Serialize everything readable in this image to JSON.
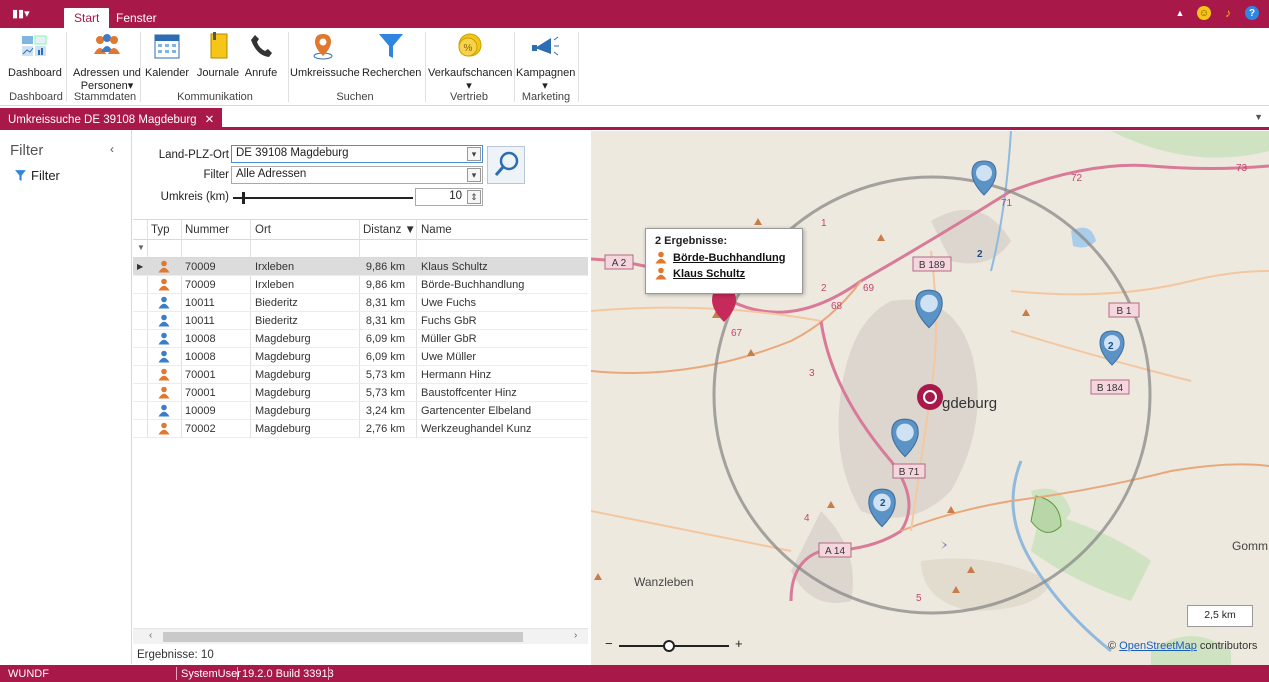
{
  "titlebar": {
    "menu_glyph": "▮▮▾",
    "tabs": [
      "Start",
      "Fenster"
    ],
    "active_tab": "Start"
  },
  "ribbon": {
    "buttons": [
      {
        "label": "Dashboard",
        "icon": "dashboard-icon"
      },
      {
        "label": "Adressen und",
        "label2": "Personen▾",
        "icon": "people-icon"
      },
      {
        "label": "Kalender",
        "icon": "calendar-icon"
      },
      {
        "label": "Journale",
        "icon": "journal-icon"
      },
      {
        "label": "Anrufe",
        "icon": "phone-icon"
      },
      {
        "label": "Umkreissuche",
        "icon": "location-pin-icon"
      },
      {
        "label": "Recherchen",
        "icon": "funnel-icon"
      },
      {
        "label": "Verkaufschancen",
        "label2": "▾",
        "icon": "percent-coin-icon"
      },
      {
        "label": "Kampagnen",
        "label2": "▾",
        "icon": "megaphone-icon"
      }
    ],
    "groups": [
      "Dashboard",
      "Stammdaten",
      "Kommunikation",
      "Suchen",
      "Vertrieb",
      "Marketing"
    ]
  },
  "doc_tab": {
    "label": "Umkreissuche DE 39108 Magdeburg",
    "close": "✕"
  },
  "left_panel": {
    "title": "Filter",
    "collapse": "‹",
    "filter_item": "Filter"
  },
  "form": {
    "plz_label": "Land-PLZ-Ort",
    "plz_value": "DE 39108 Magdeburg",
    "filter_label": "Filter",
    "filter_value": "Alle Adressen",
    "radius_label": "Umkreis (km)",
    "radius_value": "10",
    "radius_fraction": 0.05
  },
  "table": {
    "headers": [
      "Typ",
      "Nummer",
      "Ort",
      "Distanz ▼",
      "Name"
    ],
    "rows": [
      {
        "type": "orange",
        "nummer": "70009",
        "ort": "Irxleben",
        "distanz": "9,86 km",
        "name": "Klaus Schultz",
        "selected": true
      },
      {
        "type": "orange",
        "nummer": "70009",
        "ort": "Irxleben",
        "distanz": "9,86 km",
        "name": "Börde-Buchhandlung",
        "selected": false
      },
      {
        "type": "blue",
        "nummer": "10011",
        "ort": "Biederitz",
        "distanz": "8,31 km",
        "name": "Uwe Fuchs",
        "selected": false
      },
      {
        "type": "blue",
        "nummer": "10011",
        "ort": "Biederitz",
        "distanz": "8,31 km",
        "name": "Fuchs GbR",
        "selected": false
      },
      {
        "type": "blue",
        "nummer": "10008",
        "ort": "Magdeburg",
        "distanz": "6,09 km",
        "name": "Müller GbR",
        "selected": false
      },
      {
        "type": "blue",
        "nummer": "10008",
        "ort": "Magdeburg",
        "distanz": "6,09 km",
        "name": "Uwe Müller",
        "selected": false
      },
      {
        "type": "orange",
        "nummer": "70001",
        "ort": "Magdeburg",
        "distanz": "5,73 km",
        "name": "Hermann Hinz",
        "selected": false
      },
      {
        "type": "orange",
        "nummer": "70001",
        "ort": "Magdeburg",
        "distanz": "5,73 km",
        "name": "Baustoffcenter Hinz",
        "selected": false
      },
      {
        "type": "blue",
        "nummer": "10009",
        "ort": "Magdeburg",
        "distanz": "3,24 km",
        "name": "Gartencenter Elbeland",
        "selected": false
      },
      {
        "type": "orange",
        "nummer": "70002",
        "ort": "Magdeburg",
        "distanz": "2,76 km",
        "name": "Werkzeughandel Kunz",
        "selected": false
      }
    ],
    "result_count": "Ergebnisse: 10"
  },
  "map": {
    "popup_title": "2 Ergebnisse:",
    "popup_items": [
      "Börde-Buchhandlung",
      "Klaus Schultz"
    ],
    "city_label": "Magdeburg",
    "city_label_shown": "gdeburg",
    "place_labels": [
      "Wanzleben",
      "Gomm"
    ],
    "road_labels": [
      "A 2",
      "B 189",
      "B 1",
      "B 184",
      "B 71",
      "A 14",
      "73",
      "72",
      "71",
      "69",
      "68",
      "2",
      "3",
      "4",
      "1",
      "67",
      "5"
    ],
    "cluster_count": "2",
    "scale": "2,5 km",
    "copyright_prefix": "© ",
    "copyright_link": "OpenStreetMap",
    "copyright_suffix": " contributors",
    "zoom_minus": "−",
    "zoom_plus": "+",
    "zoom_level_fraction": 0.45
  },
  "status": {
    "app": "WUNDF",
    "user": "SystemUser",
    "version": "19.2.0 Build 33913"
  },
  "colors": {
    "brand": "#a8194a",
    "orange_person": "#e07830",
    "blue_person": "#3a7dc9"
  }
}
